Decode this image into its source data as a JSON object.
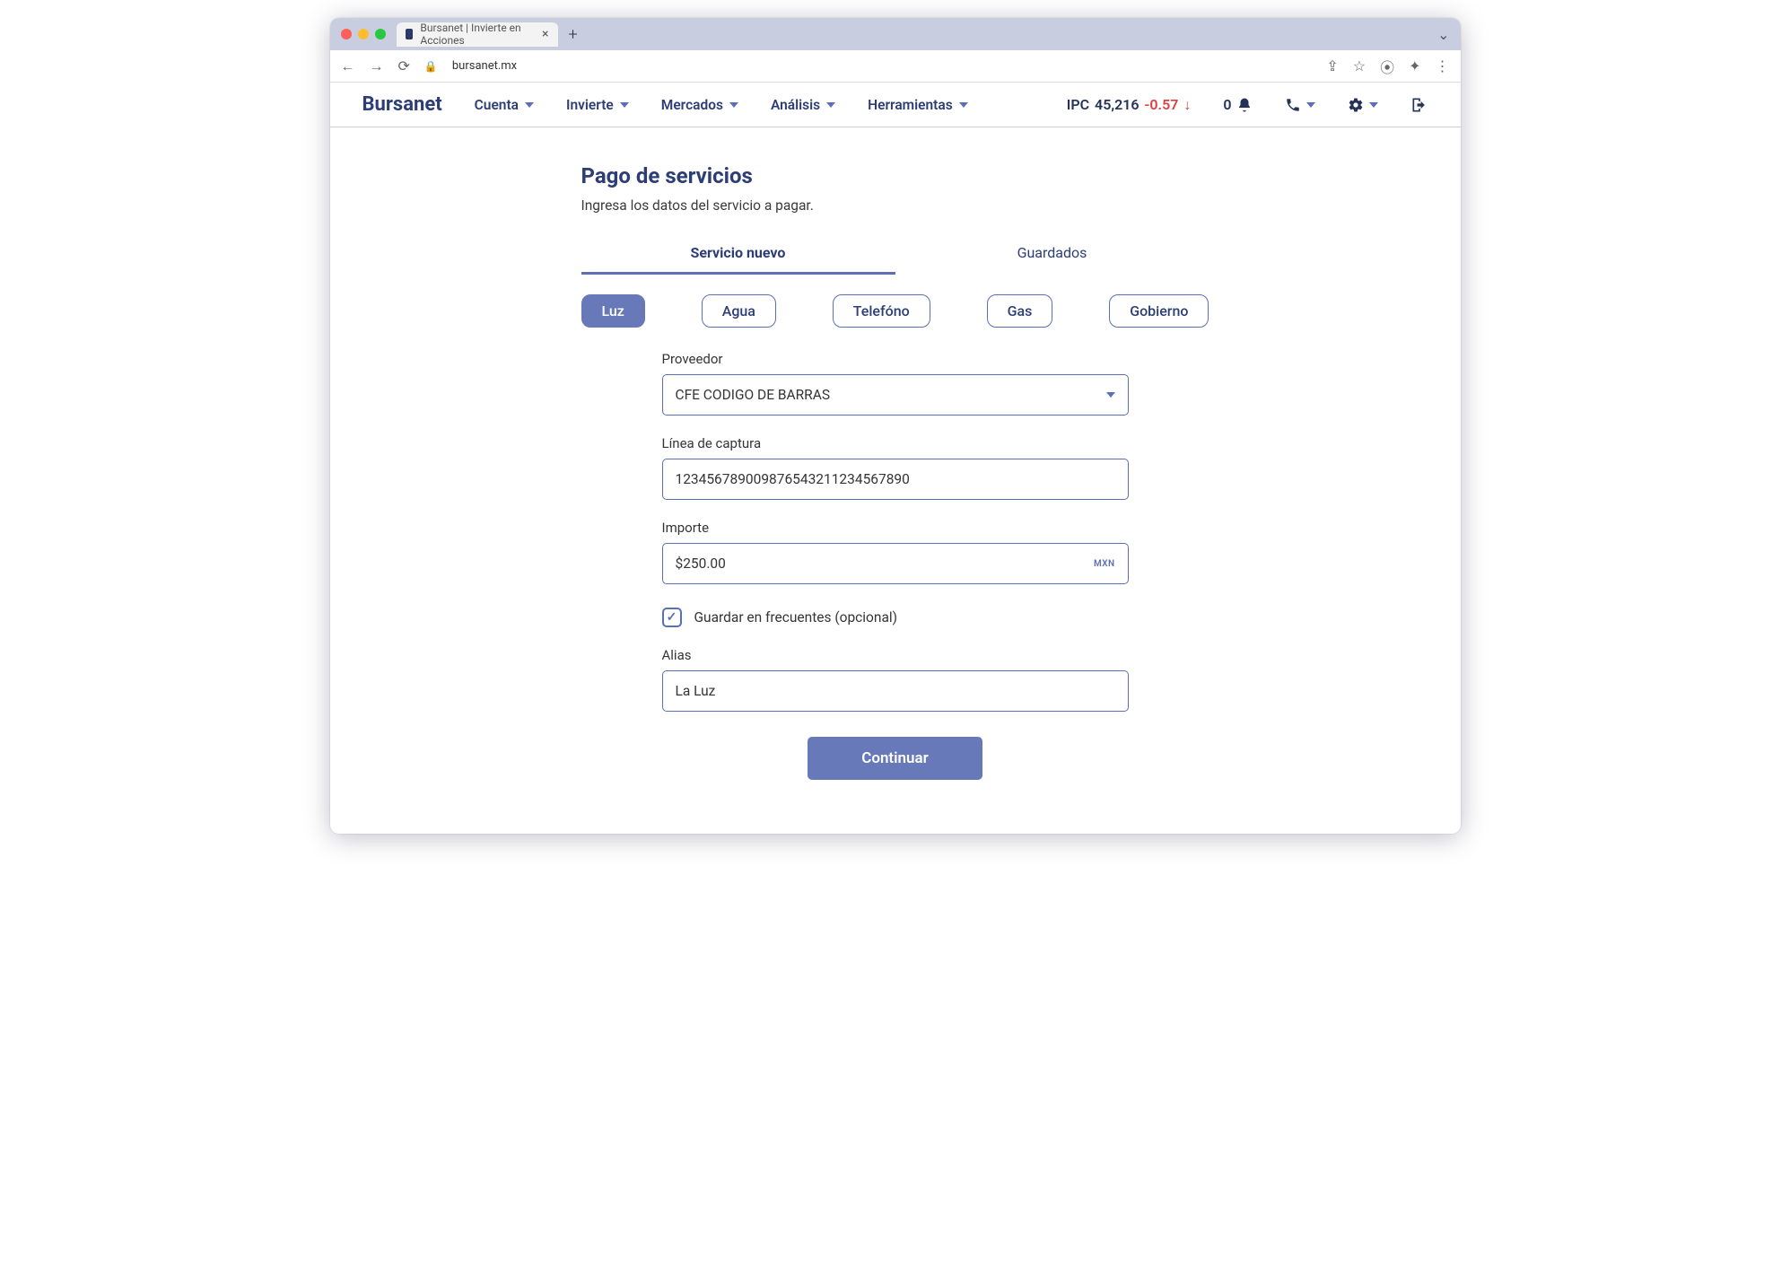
{
  "browser": {
    "tab_title": "Bursanet | Invierte en Acciones",
    "url": "bursanet.mx"
  },
  "nav": {
    "brand": "Bursanet",
    "items": [
      "Cuenta",
      "Invierte",
      "Mercados",
      "Análisis",
      "Herramientas"
    ],
    "ticker": {
      "symbol": "IPC",
      "value": "45,216",
      "change": "-0.57"
    },
    "notif_count": "0"
  },
  "page": {
    "title": "Pago de servicios",
    "subtitle": "Ingresa los datos del servicio a pagar."
  },
  "tabs": {
    "active": "Servicio nuevo",
    "inactive": "Guardados"
  },
  "chips": [
    "Luz",
    "Agua",
    "Telefóno",
    "Gas",
    "Gobierno"
  ],
  "form": {
    "proveedor_label": "Proveedor",
    "proveedor_value": "CFE CODIGO DE BARRAS",
    "linea_label": "Línea de captura",
    "linea_value": "123456789009876543211234567890",
    "importe_label": "Importe",
    "importe_value": "$250.00",
    "importe_currency": "MXN",
    "guardar_label": "Guardar en frecuentes (opcional)",
    "guardar_checked": true,
    "alias_label": "Alias",
    "alias_value": "La Luz",
    "submit": "Continuar"
  }
}
